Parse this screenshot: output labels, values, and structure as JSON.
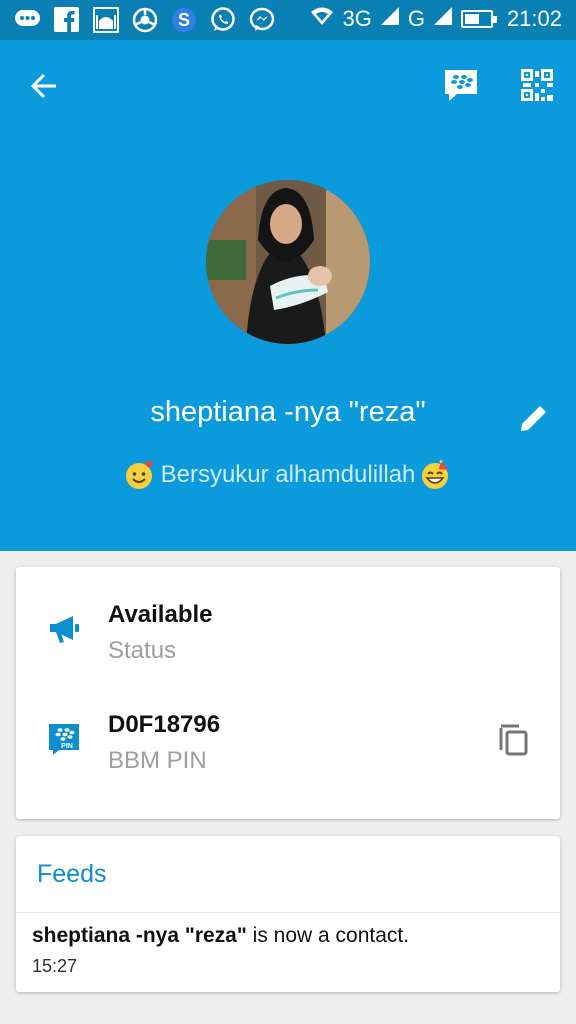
{
  "status_bar": {
    "network_1": "3G",
    "network_2": "G",
    "battery_percent": 55,
    "time": "21:02",
    "notification_icons": [
      "chat-bubble-icon",
      "facebook-icon",
      "mosque-icon",
      "chrome-icon",
      "skype-icon",
      "whatsapp-icon",
      "messenger-icon"
    ]
  },
  "profile": {
    "display_name": "sheptiana -nya \"reza\"",
    "status_message": "Bersyukur alhamdulillah"
  },
  "info": {
    "availability": "Available",
    "availability_label": "Status",
    "pin": "D0F18796",
    "pin_label": "BBM PIN"
  },
  "feeds": {
    "title": "Feeds",
    "items": [
      {
        "name": "sheptiana -nya \"reza\"",
        "text": "is now a contact.",
        "time": "15:27"
      }
    ]
  },
  "colors": {
    "header": "#0b9bdc",
    "status_bar": "#0a7fb3",
    "accent": "#0b8fd0",
    "background": "#eeeeee"
  }
}
